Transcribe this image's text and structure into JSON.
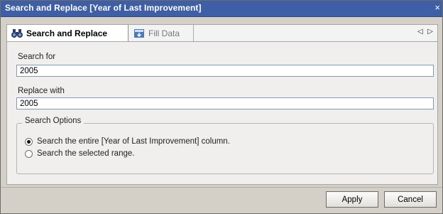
{
  "window": {
    "title": "Search and Replace  [Year of Last Improvement]",
    "close_glyph": "×"
  },
  "tabs": [
    {
      "label": "Search and Replace",
      "icon": "binoculars-icon",
      "active": true
    },
    {
      "label": "Fill Data",
      "icon": "fill-down-icon",
      "active": false
    }
  ],
  "tab_nav": {
    "prev_glyph": "◁",
    "next_glyph": "▷"
  },
  "search": {
    "label": "Search for",
    "value": "2005"
  },
  "replace": {
    "label": "Replace with",
    "value": "2005"
  },
  "options": {
    "legend": "Search Options",
    "items": [
      {
        "label": "Search the entire [Year of Last Improvement] column.",
        "checked": true
      },
      {
        "label": "Search the selected range.",
        "checked": false
      }
    ]
  },
  "buttons": {
    "apply": "Apply",
    "cancel": "Cancel"
  }
}
